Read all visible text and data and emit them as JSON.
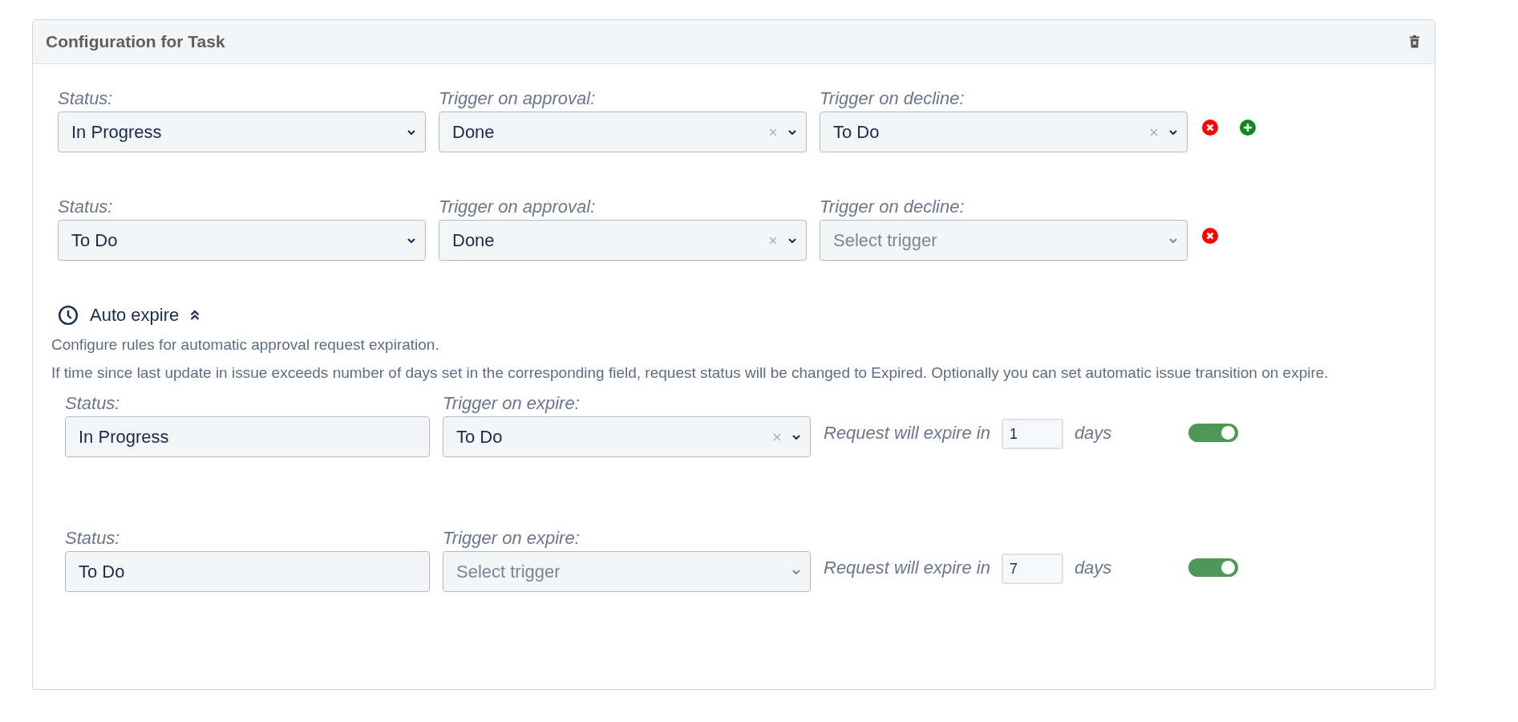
{
  "panel": {
    "title": "Configuration for Task"
  },
  "transitions": [
    {
      "status_label": "Status:",
      "status": "In Progress",
      "approval_label": "Trigger on approval:",
      "approval": {
        "value": "Done"
      },
      "decline_label": "Trigger on decline:",
      "decline": {
        "value": "To Do"
      },
      "add_button": true
    },
    {
      "status_label": "Status:",
      "status": "To Do",
      "approval_label": "Trigger on approval:",
      "approval": {
        "value": "Done"
      },
      "decline_label": "Trigger on decline:",
      "decline": {
        "placeholder": "Select trigger"
      },
      "add_button": false
    }
  ],
  "auto_expire": {
    "title": "Auto expire",
    "expanded": true,
    "description": [
      "Configure rules for automatic approval request expiration.",
      "If time since last update in issue exceeds number of days set in the corresponding field, request status will be changed to Expired. Optionally you can set automatic issue transition on expire."
    ],
    "rules": [
      {
        "status_label": "Status:",
        "status": "In Progress",
        "trigger_label": "Trigger on expire:",
        "trigger": {
          "value": "To Do"
        },
        "expire_label": "Request will expire in",
        "days": "1",
        "days_unit": "days",
        "on": true
      },
      {
        "status_label": "Status:",
        "status": "To Do",
        "trigger_label": "Trigger on expire:",
        "trigger": {
          "placeholder": "Select trigger"
        },
        "expire_label": "Request will expire in",
        "days": "7",
        "days_unit": "days",
        "on": true
      }
    ]
  }
}
